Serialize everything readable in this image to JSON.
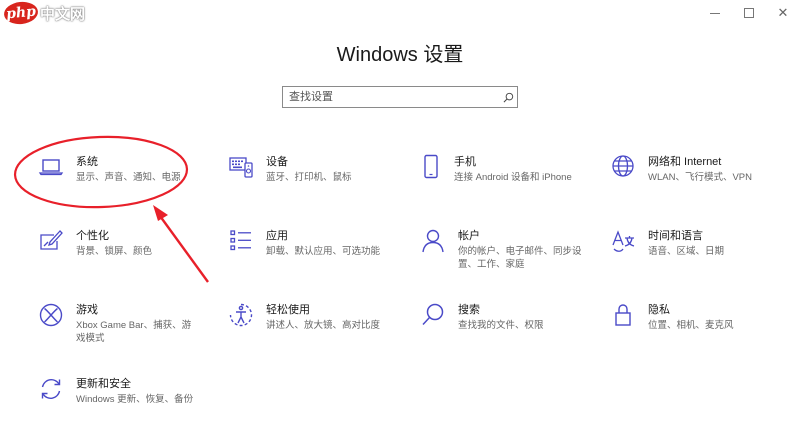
{
  "watermark": {
    "brand": "php",
    "site": "中文网"
  },
  "window": {
    "title": "Windows 设置",
    "minimize_icon": "minimize-icon",
    "maximize_icon": "maximize-icon",
    "close_icon": "close-icon",
    "close_glyph": "✕"
  },
  "search": {
    "placeholder": "查找设置",
    "icon": "search-icon"
  },
  "accent_color": "#4a4ac8",
  "annotation_color": "#e8202a",
  "categories": [
    {
      "name": "系统",
      "desc": "显示、声音、通知、电源",
      "icon": "laptop-icon"
    },
    {
      "name": "设备",
      "desc": "蓝牙、打印机、鼠标",
      "icon": "keyboard-icon"
    },
    {
      "name": "手机",
      "desc": "连接 Android 设备和 iPhone",
      "icon": "phone-icon"
    },
    {
      "name": "网络和 Internet",
      "desc": "WLAN、飞行模式、VPN",
      "icon": "globe-icon"
    },
    {
      "name": "个性化",
      "desc": "背景、锁屏、颜色",
      "icon": "paint-icon"
    },
    {
      "name": "应用",
      "desc": "卸载、默认应用、可选功能",
      "icon": "apps-list-icon"
    },
    {
      "name": "帐户",
      "desc": "你的帐户、电子邮件、同步设置、工作、家庭",
      "icon": "person-icon"
    },
    {
      "name": "时间和语言",
      "desc": "语音、区域、日期",
      "icon": "language-icon"
    },
    {
      "name": "游戏",
      "desc": "Xbox Game Bar、捕获、游戏模式",
      "icon": "xbox-icon"
    },
    {
      "name": "轻松使用",
      "desc": "讲述人、放大镜、高对比度",
      "icon": "ease-of-access-icon"
    },
    {
      "name": "搜索",
      "desc": "查找我的文件、权限",
      "icon": "search-icon"
    },
    {
      "name": "隐私",
      "desc": "位置、相机、麦克风",
      "icon": "lock-icon"
    },
    {
      "name": "更新和安全",
      "desc": "Windows 更新、恢复、备份",
      "icon": "update-icon"
    }
  ]
}
